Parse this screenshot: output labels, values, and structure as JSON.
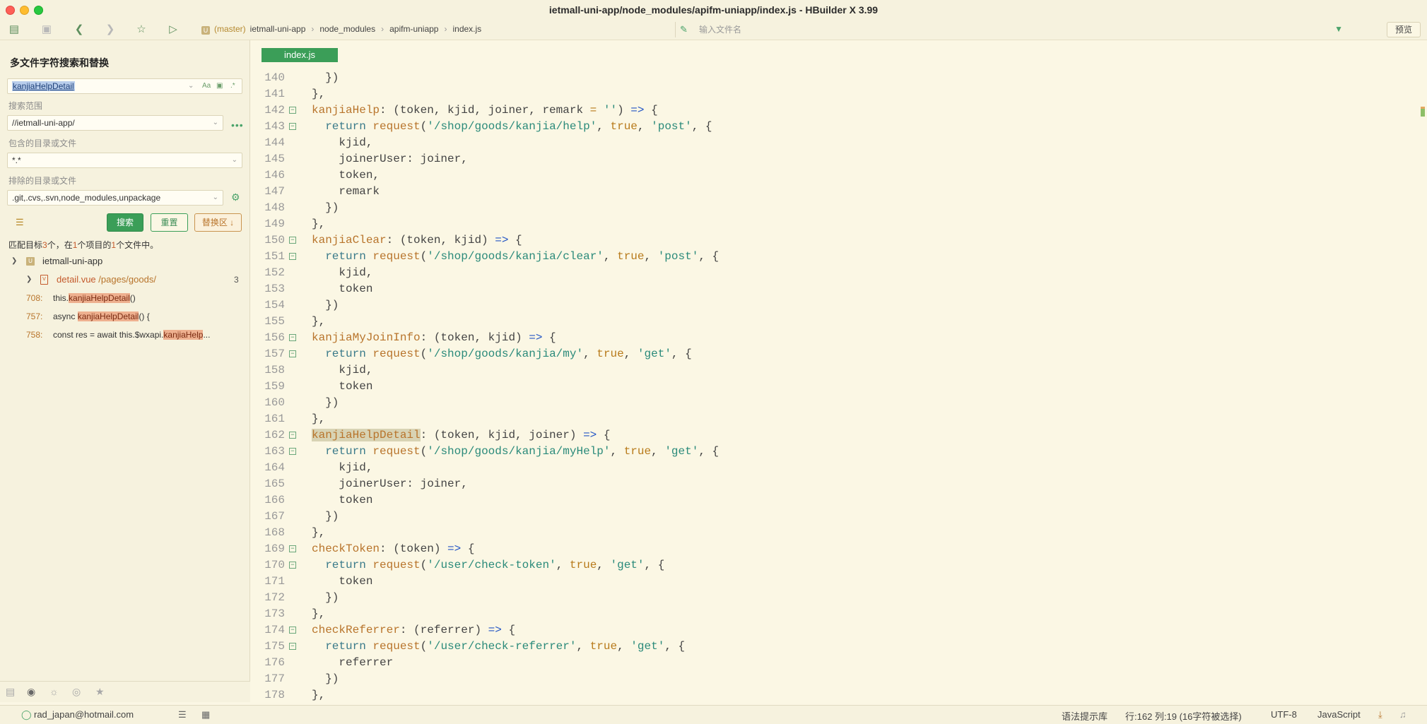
{
  "window": {
    "title": "ietmall-uni-app/node_modules/apifm-uniapp/index.js - HBuilder X 3.99"
  },
  "toolbar": {
    "breadcrumb": {
      "branch": "(master)",
      "items": [
        "ietmall-uni-app",
        "node_modules",
        "apifm-uniapp",
        "index.js"
      ]
    },
    "file_search_placeholder": "输入文件名",
    "preview_label": "预览"
  },
  "sidebar": {
    "title": "多文件字符搜索和替换",
    "search_value": "kanjiaHelpDetail",
    "scope_label": "搜索范围",
    "scope_value": "//ietmall-uni-app/",
    "include_label": "包含的目录或文件",
    "include_value": "*.*",
    "exclude_label": "排除的目录或文件",
    "exclude_value": ".git,.cvs,.svn,node_modules,unpackage",
    "search_button": "搜索",
    "reset_button": "重置",
    "replace_button": "替换区 ↓",
    "summary": {
      "prefix": "匹配目标",
      "matches": "3",
      "mid1": "个，在",
      "projects": "1",
      "mid2": "个项目的",
      "files": "1",
      "suffix": "个文件中。"
    },
    "project": "ietmall-uni-app",
    "file": {
      "name": "detail.vue",
      "path": " /pages/goods/",
      "count": "3"
    },
    "results": [
      {
        "line": "708:",
        "pre": "this.",
        "match": "kanjiaHelpDetail",
        "post": "()"
      },
      {
        "line": "757:",
        "pre": "async ",
        "match": "kanjiaHelpDetail",
        "post": "() {"
      },
      {
        "line": "758:",
        "pre": "const res = await this.$wxapi.",
        "match": "kanjiaHelp",
        "post": "..."
      }
    ]
  },
  "editor": {
    "tab": "index.js",
    "lines": [
      {
        "n": "140",
        "fold": false,
        "code": [
          [
            "",
            "  })"
          ]
        ]
      },
      {
        "n": "141",
        "fold": false,
        "code": [
          [
            "",
            "},"
          ]
        ]
      },
      {
        "n": "142",
        "fold": true,
        "code": [
          [
            "fn",
            "kanjiaHelp"
          ],
          [
            "",
            ": (token, kjid, joiner, remark "
          ],
          [
            "bool",
            "="
          ],
          [
            "",
            " "
          ],
          [
            "str",
            "''"
          ],
          [
            "",
            ") "
          ],
          [
            "arrow",
            "=>"
          ],
          [
            "",
            " {"
          ]
        ]
      },
      {
        "n": "143",
        "fold": true,
        "code": [
          [
            "kw",
            "  return "
          ],
          [
            "fn",
            "request"
          ],
          [
            "",
            "("
          ],
          [
            "str",
            "'/shop/goods/kanjia/help'"
          ],
          [
            "",
            ", "
          ],
          [
            "bool",
            "true"
          ],
          [
            "",
            ", "
          ],
          [
            "str",
            "'post'"
          ],
          [
            "",
            ", {"
          ]
        ]
      },
      {
        "n": "144",
        "fold": false,
        "code": [
          [
            "",
            "    kjid,"
          ]
        ]
      },
      {
        "n": "145",
        "fold": false,
        "code": [
          [
            "",
            "    joinerUser: joiner,"
          ]
        ]
      },
      {
        "n": "146",
        "fold": false,
        "code": [
          [
            "",
            "    token,"
          ]
        ]
      },
      {
        "n": "147",
        "fold": false,
        "code": [
          [
            "",
            "    remark"
          ]
        ]
      },
      {
        "n": "148",
        "fold": false,
        "code": [
          [
            "",
            "  })"
          ]
        ]
      },
      {
        "n": "149",
        "fold": false,
        "code": [
          [
            "",
            "},"
          ]
        ]
      },
      {
        "n": "150",
        "fold": true,
        "code": [
          [
            "fn",
            "kanjiaClear"
          ],
          [
            "",
            ": (token, kjid) "
          ],
          [
            "arrow",
            "=>"
          ],
          [
            "",
            " {"
          ]
        ]
      },
      {
        "n": "151",
        "fold": true,
        "code": [
          [
            "kw",
            "  return "
          ],
          [
            "fn",
            "request"
          ],
          [
            "",
            "("
          ],
          [
            "str",
            "'/shop/goods/kanjia/clear'"
          ],
          [
            "",
            ", "
          ],
          [
            "bool",
            "true"
          ],
          [
            "",
            ", "
          ],
          [
            "str",
            "'post'"
          ],
          [
            "",
            ", {"
          ]
        ]
      },
      {
        "n": "152",
        "fold": false,
        "code": [
          [
            "",
            "    kjid,"
          ]
        ]
      },
      {
        "n": "153",
        "fold": false,
        "code": [
          [
            "",
            "    token"
          ]
        ]
      },
      {
        "n": "154",
        "fold": false,
        "code": [
          [
            "",
            "  })"
          ]
        ]
      },
      {
        "n": "155",
        "fold": false,
        "code": [
          [
            "",
            "},"
          ]
        ]
      },
      {
        "n": "156",
        "fold": true,
        "code": [
          [
            "fn",
            "kanjiaMyJoinInfo"
          ],
          [
            "",
            ": (token, kjid) "
          ],
          [
            "arrow",
            "=>"
          ],
          [
            "",
            " {"
          ]
        ]
      },
      {
        "n": "157",
        "fold": true,
        "code": [
          [
            "kw",
            "  return "
          ],
          [
            "fn",
            "request"
          ],
          [
            "",
            "("
          ],
          [
            "str",
            "'/shop/goods/kanjia/my'"
          ],
          [
            "",
            ", "
          ],
          [
            "bool",
            "true"
          ],
          [
            "",
            ", "
          ],
          [
            "str",
            "'get'"
          ],
          [
            "",
            ", {"
          ]
        ]
      },
      {
        "n": "158",
        "fold": false,
        "code": [
          [
            "",
            "    kjid,"
          ]
        ]
      },
      {
        "n": "159",
        "fold": false,
        "code": [
          [
            "",
            "    token"
          ]
        ]
      },
      {
        "n": "160",
        "fold": false,
        "code": [
          [
            "",
            "  })"
          ]
        ]
      },
      {
        "n": "161",
        "fold": false,
        "code": [
          [
            "",
            "},"
          ]
        ]
      },
      {
        "n": "162",
        "fold": true,
        "code": [
          [
            "fnhl",
            "kanjiaHelpDetail"
          ],
          [
            "",
            ": (token, kjid, joiner) "
          ],
          [
            "arrow",
            "=>"
          ],
          [
            "",
            " {"
          ]
        ]
      },
      {
        "n": "163",
        "fold": true,
        "code": [
          [
            "kw",
            "  return "
          ],
          [
            "fn",
            "request"
          ],
          [
            "",
            "("
          ],
          [
            "str",
            "'/shop/goods/kanjia/myHelp'"
          ],
          [
            "",
            ", "
          ],
          [
            "bool",
            "true"
          ],
          [
            "",
            ", "
          ],
          [
            "str",
            "'get'"
          ],
          [
            "",
            ", {"
          ]
        ]
      },
      {
        "n": "164",
        "fold": false,
        "code": [
          [
            "",
            "    kjid,"
          ]
        ]
      },
      {
        "n": "165",
        "fold": false,
        "code": [
          [
            "",
            "    joinerUser: joiner,"
          ]
        ]
      },
      {
        "n": "166",
        "fold": false,
        "code": [
          [
            "",
            "    token"
          ]
        ]
      },
      {
        "n": "167",
        "fold": false,
        "code": [
          [
            "",
            "  })"
          ]
        ]
      },
      {
        "n": "168",
        "fold": false,
        "code": [
          [
            "",
            "},"
          ]
        ]
      },
      {
        "n": "169",
        "fold": true,
        "code": [
          [
            "fn",
            "checkToken"
          ],
          [
            "",
            ": (token) "
          ],
          [
            "arrow",
            "=>"
          ],
          [
            "",
            " {"
          ]
        ]
      },
      {
        "n": "170",
        "fold": true,
        "code": [
          [
            "kw",
            "  return "
          ],
          [
            "fn",
            "request"
          ],
          [
            "",
            "("
          ],
          [
            "str",
            "'/user/check-token'"
          ],
          [
            "",
            ", "
          ],
          [
            "bool",
            "true"
          ],
          [
            "",
            ", "
          ],
          [
            "str",
            "'get'"
          ],
          [
            "",
            ", {"
          ]
        ]
      },
      {
        "n": "171",
        "fold": false,
        "code": [
          [
            "",
            "    token"
          ]
        ]
      },
      {
        "n": "172",
        "fold": false,
        "code": [
          [
            "",
            "  })"
          ]
        ]
      },
      {
        "n": "173",
        "fold": false,
        "code": [
          [
            "",
            "},"
          ]
        ]
      },
      {
        "n": "174",
        "fold": true,
        "code": [
          [
            "fn",
            "checkReferrer"
          ],
          [
            "",
            ": (referrer) "
          ],
          [
            "arrow",
            "=>"
          ],
          [
            "",
            " {"
          ]
        ]
      },
      {
        "n": "175",
        "fold": true,
        "code": [
          [
            "kw",
            "  return "
          ],
          [
            "fn",
            "request"
          ],
          [
            "",
            "("
          ],
          [
            "str",
            "'/user/check-referrer'"
          ],
          [
            "",
            ", "
          ],
          [
            "bool",
            "true"
          ],
          [
            "",
            ", "
          ],
          [
            "str",
            "'get'"
          ],
          [
            "",
            ", {"
          ]
        ]
      },
      {
        "n": "176",
        "fold": false,
        "code": [
          [
            "",
            "    referrer"
          ]
        ]
      },
      {
        "n": "177",
        "fold": false,
        "code": [
          [
            "",
            "  })"
          ]
        ]
      },
      {
        "n": "178",
        "fold": false,
        "code": [
          [
            "",
            "},"
          ]
        ]
      }
    ]
  },
  "statusbar": {
    "user": "rad_japan@hotmail.com",
    "syntax_hint": "语法提示库",
    "position": "行:162  列:19 (16字符被选择)",
    "encoding": "UTF-8",
    "language": "JavaScript"
  }
}
